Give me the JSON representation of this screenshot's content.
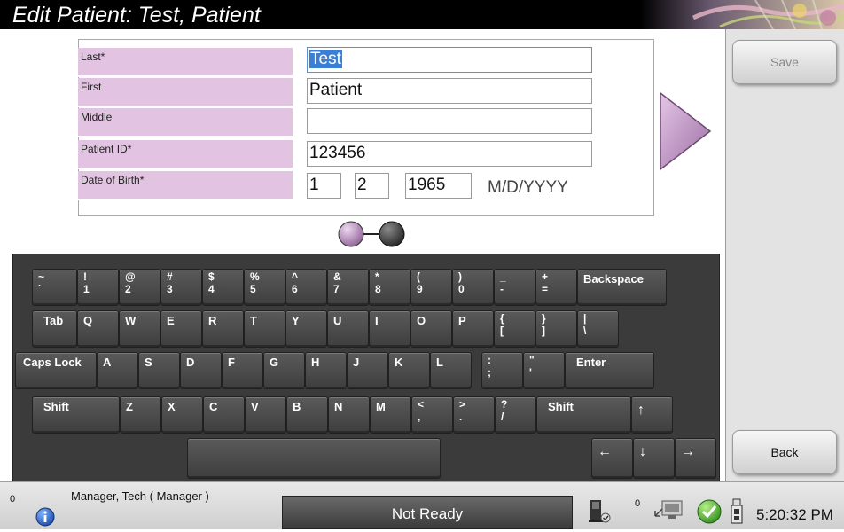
{
  "title": "Edit Patient: Test, Patient",
  "form": {
    "fields": [
      {
        "label": "Last*",
        "value": "Test",
        "active": true
      },
      {
        "label": "First",
        "value": "Patient"
      },
      {
        "label": "Middle",
        "value": ""
      },
      {
        "label": "Patient ID*",
        "value": "123456"
      }
    ],
    "dob": {
      "label": "Date of Birth*",
      "month": "1",
      "day": "2",
      "year": "1965",
      "format": "M/D/YYYY"
    }
  },
  "pager": {
    "page_count": 2,
    "current_page": 1
  },
  "buttons": {
    "save": "Save",
    "back": "Back"
  },
  "keyboard": {
    "rows": [
      [
        {
          "top": "~",
          "bottom": "`"
        },
        {
          "top": "!",
          "bottom": "1"
        },
        {
          "top": "@",
          "bottom": "2"
        },
        {
          "top": "#",
          "bottom": "3"
        },
        {
          "top": "$",
          "bottom": "4"
        },
        {
          "top": "%",
          "bottom": "5"
        },
        {
          "top": "^",
          "bottom": "6"
        },
        {
          "top": "&",
          "bottom": "7"
        },
        {
          "top": "*",
          "bottom": "8"
        },
        {
          "top": "(",
          "bottom": "9"
        },
        {
          "top": ")",
          "bottom": "0"
        },
        {
          "top": "_",
          "bottom": "-"
        },
        {
          "top": "+",
          "bottom": "="
        },
        {
          "label": "Backspace"
        }
      ],
      [
        {
          "label": "Tab"
        },
        {
          "label": "Q"
        },
        {
          "label": "W"
        },
        {
          "label": "E"
        },
        {
          "label": "R"
        },
        {
          "label": "T"
        },
        {
          "label": "Y"
        },
        {
          "label": "U"
        },
        {
          "label": "I"
        },
        {
          "label": "O"
        },
        {
          "label": "P"
        },
        {
          "top": "{",
          "bottom": "["
        },
        {
          "top": "}",
          "bottom": "]"
        },
        {
          "top": "|",
          "bottom": "\\"
        }
      ],
      [
        {
          "label": "Caps Lock"
        },
        {
          "label": "A"
        },
        {
          "label": "S"
        },
        {
          "label": "D"
        },
        {
          "label": "F"
        },
        {
          "label": "G"
        },
        {
          "label": "H"
        },
        {
          "label": "J"
        },
        {
          "label": "K"
        },
        {
          "label": "L"
        },
        {
          "top": ":",
          "bottom": ";"
        },
        {
          "top": "\"",
          "bottom": "'"
        },
        {
          "label": "Enter"
        }
      ],
      [
        {
          "label": "Shift"
        },
        {
          "label": "Z"
        },
        {
          "label": "X"
        },
        {
          "label": "C"
        },
        {
          "label": "V"
        },
        {
          "label": "B"
        },
        {
          "label": "N"
        },
        {
          "label": "M"
        },
        {
          "top": "<",
          "bottom": ","
        },
        {
          "top": ">",
          "bottom": "."
        },
        {
          "top": "?",
          "bottom": "/"
        },
        {
          "label": "Shift"
        },
        {
          "label": "↑"
        }
      ],
      [
        {
          "label": ""
        },
        {
          "label": "←"
        },
        {
          "label": "↓"
        },
        {
          "label": "→"
        }
      ]
    ]
  },
  "statusbar": {
    "left_count": "0",
    "user": "Manager, Tech ( Manager )",
    "status": "Not Ready",
    "tray_count": "0",
    "clock": "5:20:32 PM"
  },
  "colors": {
    "label_bg": "#e2c3e2",
    "accent_purple": "#b48ab8",
    "keyboard_bg": "#3b3b3b"
  }
}
